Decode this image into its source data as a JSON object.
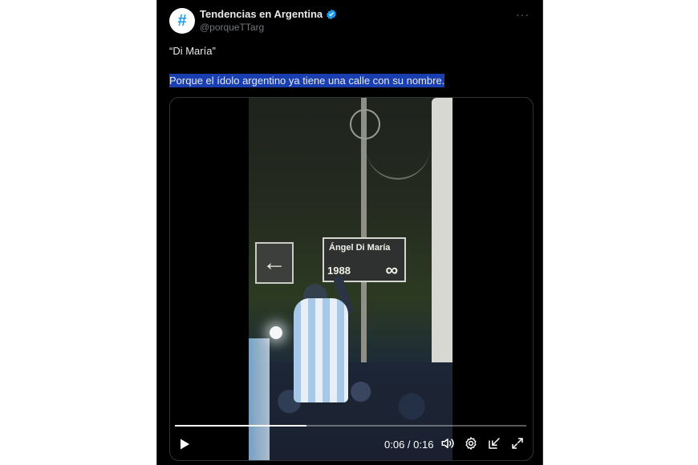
{
  "tweet": {
    "author_name": "Tendencias en Argentina",
    "author_handle": "@porqueTTarg",
    "avatar_glyph": "#",
    "more_label": "···",
    "text_line1": "“Di María”",
    "text_line2": "Porque el ídolo argentino ya tiene una calle con su nombre."
  },
  "video": {
    "sign_name": "Ángel Di María",
    "sign_year": "1988",
    "sign_infinity": "∞",
    "arrow_glyph": "←",
    "time_display": "0:06 / 0:16",
    "progress_fraction": 0.375
  },
  "icons": {
    "verified": "verified-badge-icon",
    "play": "play-icon",
    "volume": "volume-icon",
    "settings": "gear-icon",
    "pip": "picture-in-picture-icon",
    "fullscreen": "fullscreen-icon"
  },
  "colors": {
    "background": "#000000",
    "text": "#e7e9ea",
    "secondary": "#71767b",
    "highlight": "#1a3fb0",
    "brand_blue": "#1d9bf0"
  }
}
